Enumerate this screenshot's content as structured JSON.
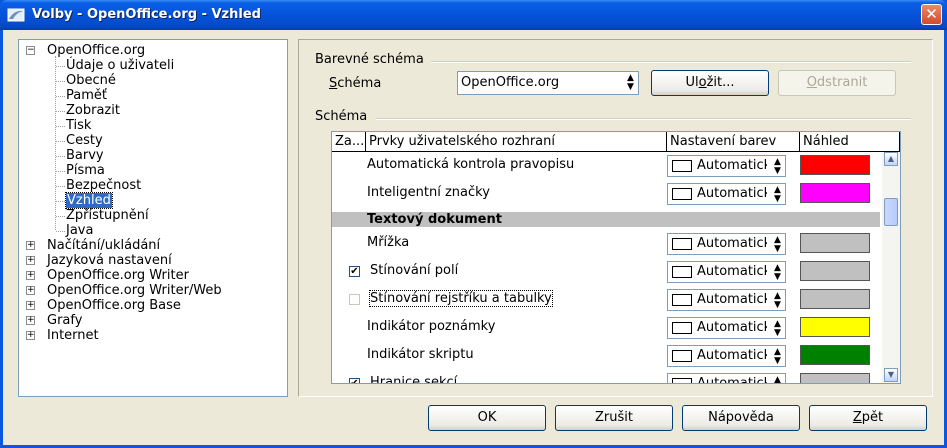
{
  "window": {
    "title": "Volby - OpenOffice.org - Vzhled",
    "close_symbol": "✕"
  },
  "tree": {
    "root": {
      "label": "OpenOffice.org",
      "expander": "−"
    },
    "children": [
      "Údaje o uživateli",
      "Obecné",
      "Paměť",
      "Zobrazit",
      "Tisk",
      "Cesty",
      "Barvy",
      "Písma",
      "Bezpečnost",
      "Vzhled",
      "Zpřístupnění",
      "Java"
    ],
    "selected": "Vzhled",
    "top_level": [
      {
        "label": "Načítání/ukládání",
        "expander": "+"
      },
      {
        "label": "Jazyková nastavení",
        "expander": "+"
      },
      {
        "label": "OpenOffice.org Writer",
        "expander": "+"
      },
      {
        "label": "OpenOffice.org Writer/Web",
        "expander": "+"
      },
      {
        "label": "OpenOffice.org Base",
        "expander": "+"
      },
      {
        "label": "Grafy",
        "expander": "+"
      },
      {
        "label": "Internet",
        "expander": "+"
      }
    ]
  },
  "color_scheme_group": {
    "title": "Barevné schéma",
    "scheme_label": "Schéma",
    "scheme_value": "OpenOffice.org",
    "save_button": "Uložit...",
    "delete_button": "Odstranit"
  },
  "scheme_group": {
    "title": "Schéma",
    "columns": [
      "Za...",
      "Prvky uživatelského rozhraní",
      "Nastavení barev",
      "Náhled"
    ],
    "rows": [
      {
        "type": "item",
        "label": "Automatická kontrola pravopisu",
        "checkbox": null,
        "color_setting": "Automaticky",
        "preview_color": "#ff0000"
      },
      {
        "type": "item",
        "label": "Inteligentní značky",
        "checkbox": null,
        "color_setting": "Automaticky",
        "preview_color": "#ff00ff"
      },
      {
        "type": "section",
        "label": "Textový dokument"
      },
      {
        "type": "item",
        "label": "Mřížka",
        "checkbox": null,
        "color_setting": "Automaticky",
        "preview_color": "#c0c0c0"
      },
      {
        "type": "item",
        "label": "Stínování polí",
        "checkbox": "checked",
        "color_setting": "Automaticky",
        "preview_color": "#c0c0c0"
      },
      {
        "type": "item",
        "label": "Stínování rejstříku a tabulky",
        "checkbox": "unchecked-disabled",
        "color_setting": "Automaticky",
        "preview_color": "#c0c0c0"
      },
      {
        "type": "item",
        "label": "Indikátor poznámky",
        "checkbox": null,
        "color_setting": "Automaticky",
        "preview_color": "#ffff00"
      },
      {
        "type": "item",
        "label": "Indikátor skriptu",
        "checkbox": null,
        "color_setting": "Automaticky",
        "preview_color": "#008000"
      },
      {
        "type": "item",
        "label": "Hranice sekcí",
        "checkbox": "checked",
        "color_setting": "Automaticky",
        "preview_color": "#c0c0c0"
      }
    ]
  },
  "footer": {
    "ok": "OK",
    "cancel": "Zrušit",
    "help": "Nápověda",
    "back": "Zpět"
  },
  "icons": {
    "spin_up": "▲",
    "spin_down": "▼",
    "check_mark": "✔"
  }
}
